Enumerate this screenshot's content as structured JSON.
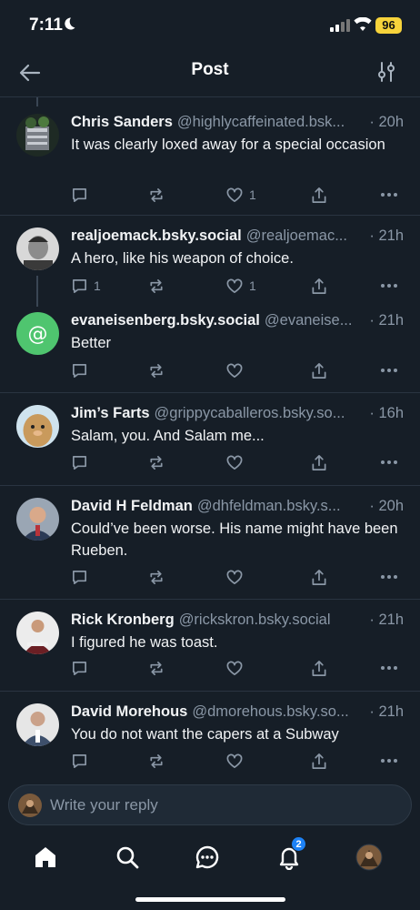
{
  "status": {
    "time": "7:11",
    "battery": "96"
  },
  "header": {
    "title": "Post"
  },
  "posts": [
    {
      "name": "Chris Sanders",
      "handle": "@highlycaffeinated.bsk...",
      "time": "· 20h",
      "text": "It was clearly loxed away for a special occasion",
      "replies": "",
      "likes": "1"
    },
    {
      "name": "realjoemack.bsky.social",
      "handle": "@realjoemac...",
      "time": "· 21h",
      "text": "A hero, like his weapon of choice.",
      "replies": "1",
      "likes": "1"
    },
    {
      "name": "evaneisenberg.bsky.social",
      "handle": "@evaneise...",
      "time": "· 21h",
      "text": "Better",
      "replies": "",
      "likes": ""
    },
    {
      "name": "Jim’s Farts",
      "handle": "@grippycaballeros.bsky.so...",
      "time": "· 16h",
      "text": "Salam, you. And Salam me...",
      "replies": "",
      "likes": ""
    },
    {
      "name": "David H Feldman",
      "handle": "@dhfeldman.bsky.s...",
      "time": "· 20h",
      "text": "Could’ve been worse. His name might have been Rueben.",
      "replies": "",
      "likes": ""
    },
    {
      "name": "Rick Kronberg",
      "handle": "@rickskron.bsky.social",
      "time": "· 21h",
      "text": "I figured he was toast.",
      "replies": "",
      "likes": ""
    },
    {
      "name": "David Morehous",
      "handle": "@dmorehous.bsky.so...",
      "time": "· 21h",
      "text": "You do not want the capers at a Subway",
      "replies": "",
      "likes": ""
    }
  ],
  "reply": {
    "placeholder": "Write your reply"
  },
  "tabs": {
    "notifications_badge": "2"
  },
  "colors": {
    "background": "#161e27",
    "accent": "#1d82f6",
    "muted": "#8a97a6",
    "battery": "#f7d33b"
  }
}
